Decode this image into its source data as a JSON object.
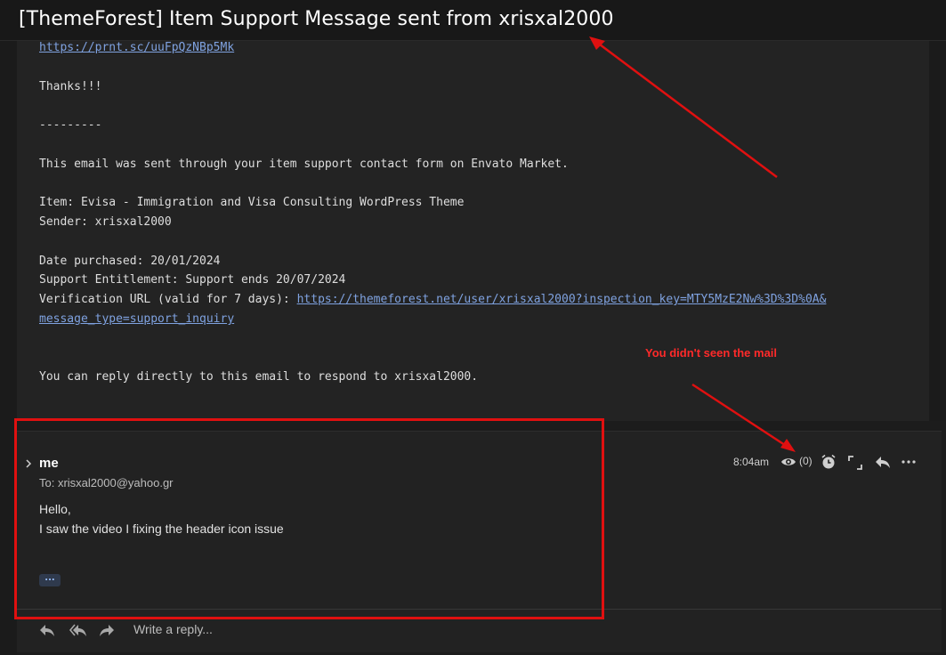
{
  "email": {
    "subject": "[ThemeForest] Item Support Message sent from xrisxal2000",
    "lines": {
      "link_prnt": "https://prnt.sc/uuFpQzNBp5Mk",
      "thanks": "Thanks!!!",
      "separator": "---------",
      "sent_through": "This email was sent through your item support contact form on Envato Market.",
      "item": "Item: Evisa - Immigration and Visa Consulting WordPress Theme",
      "sender": "Sender: xrisxal2000",
      "date_purchased": "Date purchased: 20/01/2024",
      "support_entitlement": "Support Entitlement: Support ends 20/07/2024",
      "verification_label": "Verification URL (valid for 7 days): ",
      "verification_link_1": "https://themeforest.net/user/xrisxal2000?inspection_key=MTY5MzE2Nw%3D%3D%0A&",
      "verification_link_2": "message_type=support_inquiry",
      "reply_note": "You can reply directly to this email to respond to xrisxal2000."
    }
  },
  "reply_message": {
    "sender": "me",
    "to": "To: xrisxal2000@yahoo.gr",
    "time": "8:04am",
    "view_count": "(0)",
    "body": [
      "Hello,",
      "I saw the video I fixing the header icon issue"
    ],
    "ellipsis": "..."
  },
  "reply_bar": {
    "placeholder": "Write a reply..."
  },
  "annotations": {
    "note": "You didn't seen the mail",
    "color": "#e01010"
  }
}
